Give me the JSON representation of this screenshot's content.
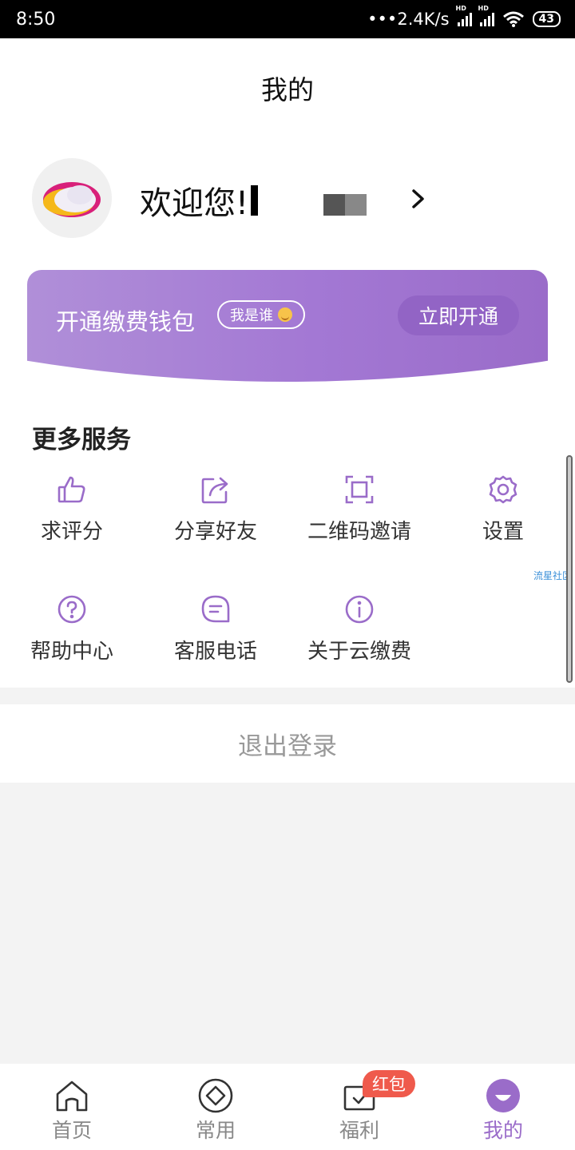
{
  "status_bar": {
    "time": "8:50",
    "network_speed": "2.4K/s",
    "hd_label": "HD",
    "battery": "43"
  },
  "header": {
    "title": "我的"
  },
  "profile": {
    "welcome": "欢迎您!",
    "avatar_icon": "cloud-logo-icon",
    "arrow_icon": "chevron-right-icon"
  },
  "wallet_banner": {
    "title": "开通缴费钱包",
    "who_badge": "我是谁",
    "open_button": "立即开通",
    "colors": {
      "start": "#b08fd8",
      "end": "#9a6cc9",
      "button": "#9264c5"
    }
  },
  "services": {
    "title": "更多服务",
    "items": [
      {
        "label": "求评分",
        "icon": "thumbs-up-icon"
      },
      {
        "label": "分享好友",
        "icon": "share-icon"
      },
      {
        "label": "二维码邀请",
        "icon": "qr-scan-icon"
      },
      {
        "label": "设置",
        "icon": "gear-icon"
      },
      {
        "label": "帮助中心",
        "icon": "question-circle-icon"
      },
      {
        "label": "客服电话",
        "icon": "chat-bubble-icon"
      },
      {
        "label": "关于云缴费",
        "icon": "info-circle-icon"
      }
    ]
  },
  "watermark": "流星社区",
  "logout": {
    "label": "退出登录"
  },
  "bottom_nav": {
    "items": [
      {
        "label": "首页",
        "icon": "home-icon"
      },
      {
        "label": "常用",
        "icon": "diamond-icon"
      },
      {
        "label": "福利",
        "icon": "gift-box-icon",
        "badge": "红包"
      },
      {
        "label": "我的",
        "icon": "smile-face-icon",
        "active": true
      }
    ],
    "accent_color": "#9a6cc9"
  }
}
